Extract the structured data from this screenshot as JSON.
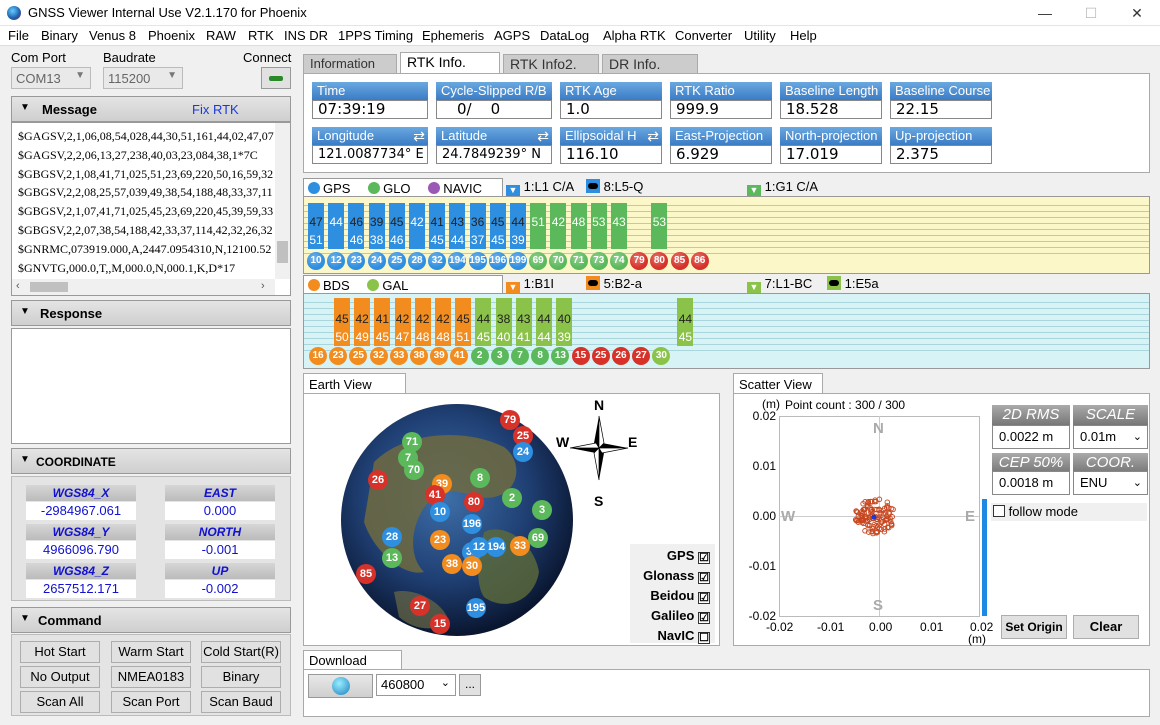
{
  "window": {
    "title": "GNSS Viewer Internal Use V2.1.170 for Phoenix",
    "minimize": "—",
    "maximize": "☐",
    "close": "✕"
  },
  "menu": [
    "File",
    "Binary",
    "Venus 8",
    "Phoenix",
    "RAW",
    "RTK",
    "INS DR",
    "1PPS Timing",
    "Ephemeris",
    "AGPS",
    "DataLog",
    "Alpha RTK",
    "Converter",
    "Utility",
    "Help"
  ],
  "conn": {
    "com_label": "Com Port",
    "com_value": "COM13",
    "baud_label": "Baudrate",
    "baud_value": "115200",
    "connect_label": "Connect"
  },
  "message": {
    "title": "Message",
    "fix": "Fix RTK",
    "lines": [
      "$GAGSV,2,1,06,08,54,028,44,30,51,161,44,02,47,07",
      "$GAGSV,2,2,06,13,27,238,40,03,23,084,38,1*7C",
      "$GBGSV,2,1,08,41,71,025,51,23,69,220,50,16,59,32",
      "$GBGSV,2,2,08,25,57,039,49,38,54,188,48,33,37,11",
      "$GBGSV,2,1,07,41,71,025,45,23,69,220,45,39,59,33",
      "$GBGSV,2,2,07,38,54,188,42,33,37,114,42,32,26,32",
      "$GNRMC,073919.000,A,2447.0954310,N,12100.52",
      "$GNVTG,000.0,T,,M,000.0,N,000.1,K,D*17"
    ]
  },
  "response": {
    "title": "Response"
  },
  "coordinate": {
    "title": "COORDINATE",
    "x_label": "WGS84_X",
    "x_value": "-2984967.061",
    "y_label": "WGS84_Y",
    "y_value": "4966096.790",
    "z_label": "WGS84_Z",
    "z_value": "2657512.171",
    "east_label": "EAST",
    "east_value": "0.000",
    "north_label": "NORTH",
    "north_value": "-0.001",
    "up_label": "UP",
    "up_value": "-0.002"
  },
  "command": {
    "title": "Command",
    "buttons": [
      "Hot Start",
      "Warm Start",
      "Cold Start(R)",
      "No Output",
      "NMEA0183",
      "Binary",
      "Scan All",
      "Scan Port",
      "Scan Baud"
    ]
  },
  "tabs": [
    "Information",
    "RTK Info.",
    "RTK Info2.",
    "DR Info."
  ],
  "rtk": {
    "time_l": "Time",
    "time_v": "07:39:19",
    "cs_l": "Cycle-Slipped R/B",
    "cs_v": "0/    0",
    "age_l": "RTK  Age",
    "age_v": "1.0",
    "ratio_l": "RTK  Ratio",
    "ratio_v": "999.9",
    "bl_l": "Baseline  Length",
    "bl_v": "18.528",
    "bc_l": "Baseline  Course",
    "bc_v": "22.15",
    "lon_l": "Longitude",
    "lon_v": "121.0087734° E",
    "lat_l": "Latitude",
    "lat_v": "24.7849239° N",
    "eh_l": "Ellipsoidal H",
    "eh_v": "116.10",
    "ep_l": "East-Projection",
    "ep_v": "6.929",
    "np_l": "North-projection",
    "np_v": "17.019",
    "up_l": "Up-projection",
    "up_v": "2.375"
  },
  "snr1": {
    "legend": [
      "GPS",
      "GLO",
      "NAVIC"
    ],
    "signals": [
      "1:L1 C/A",
      "8:L5-Q",
      "1:G1 C/A"
    ],
    "top": [
      "47",
      "",
      "46",
      "39",
      "45",
      "",
      "41",
      "43",
      "36",
      "45",
      "44",
      "",
      "",
      "",
      "",
      "",
      "",
      "",
      ""
    ],
    "bottom": [
      "51",
      "44",
      "46",
      "38",
      "46",
      "42",
      "45",
      "44",
      "37",
      "45",
      "39",
      "51",
      "42",
      "48",
      "53",
      "43",
      "",
      "53",
      ""
    ],
    "prns": [
      "10",
      "12",
      "23",
      "24",
      "25",
      "28",
      "32",
      "194",
      "195",
      "196",
      "199",
      "69",
      "70",
      "71",
      "73",
      "74",
      "79",
      "80",
      "85",
      "86"
    ]
  },
  "snr2": {
    "legend": [
      "BDS",
      "GAL"
    ],
    "signals": [
      "1:B1I",
      "5:B2-a",
      "7:L1-BC",
      "1:E5a"
    ],
    "top": [
      "45",
      "42",
      "41",
      "42",
      "42",
      "42",
      "45",
      "44",
      "38",
      "43",
      "44",
      "40",
      "",
      "",
      "",
      "",
      "",
      "44"
    ],
    "bottom": [
      "50",
      "49",
      "45",
      "47",
      "48",
      "48",
      "51",
      "45",
      "40",
      "41",
      "44",
      "39",
      "",
      "",
      "",
      "",
      "",
      "45"
    ],
    "prns": [
      "16",
      "23",
      "25",
      "32",
      "33",
      "38",
      "39",
      "41",
      "2",
      "3",
      "7",
      "8",
      "13",
      "15",
      "25",
      "26",
      "27",
      "30"
    ]
  },
  "earth": {
    "title": "Earth View",
    "compass": {
      "n": "N",
      "s": "S",
      "e": "E",
      "w": "W"
    },
    "filters": [
      {
        "name": "GPS",
        "on": "☑"
      },
      {
        "name": "Glonass",
        "on": "☑"
      },
      {
        "name": "Beidou",
        "on": "☑"
      },
      {
        "name": "Galileo",
        "on": "☑"
      },
      {
        "name": "NavIC",
        "on": "☐"
      }
    ],
    "sats": [
      "79",
      "25",
      "24",
      "71",
      "7",
      "70",
      "26",
      "39",
      "41",
      "8",
      "2",
      "10",
      "3",
      "196",
      "28",
      "23",
      "32",
      "194",
      "33",
      "69",
      "13",
      "38",
      "30",
      "85",
      "27",
      "195",
      "15",
      "12",
      "80"
    ]
  },
  "scatter": {
    "title": "Scatter View",
    "unit": "(m)",
    "count": "Point count : 300 / 300",
    "yticks": [
      "0.02",
      "0.01",
      "0.00",
      "-0.01",
      "-0.02"
    ],
    "xticks": [
      "-0.02",
      "-0.01",
      "0.00",
      "0.01",
      "0.02"
    ],
    "n": "N",
    "s": "S",
    "e": "E",
    "w": "W",
    "rms_l": "2D RMS",
    "rms_v": "0.0022 m",
    "scale_l": "SCALE",
    "scale_v": "0.01m",
    "cep_l": "CEP 50%",
    "cep_v": "0.0018 m",
    "coor_l": "COOR.",
    "coor_v": "ENU",
    "follow": "follow mode",
    "set_origin": "Set Origin",
    "clear": "Clear"
  },
  "download": {
    "title": "Download",
    "baud": "460800",
    "browse": "..."
  }
}
